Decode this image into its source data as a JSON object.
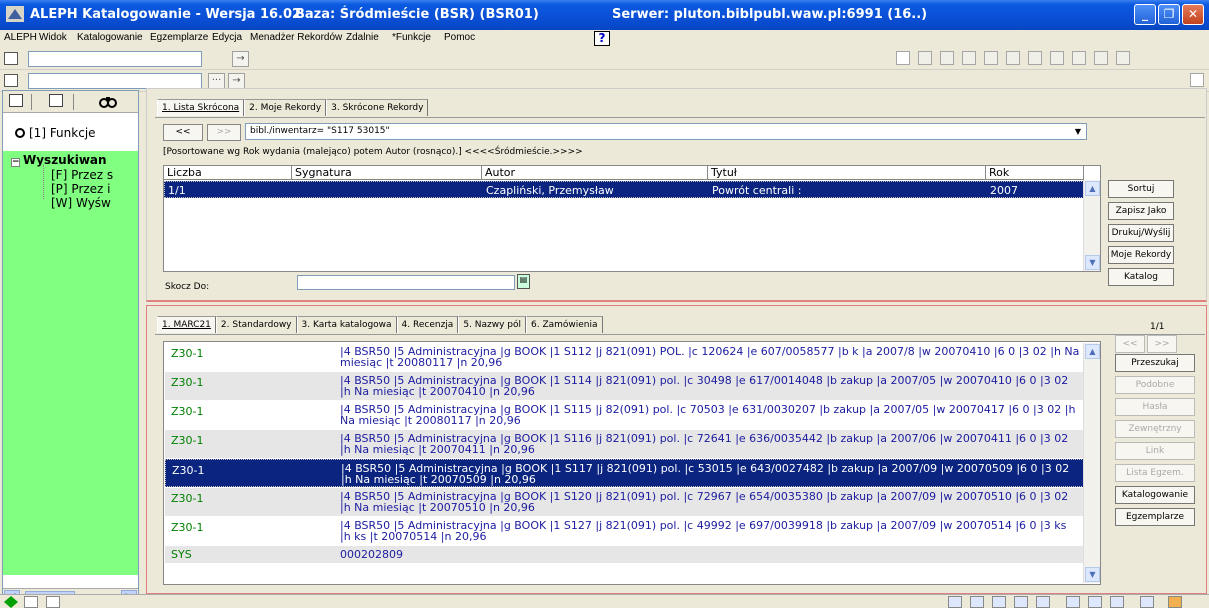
{
  "window": {
    "app_title": "ALEPH Katalogowanie - Wersja 16.02",
    "base": "Baza:  Śródmieście (BSR) (BSR01)",
    "server": "Serwer:  pluton.biblpubl.waw.pl:6991 (16..)"
  },
  "menu": [
    "ALEPH",
    "Widok",
    "Katalogowanie",
    "Egzemplarze",
    "Edycja",
    "Menadżer Rekordów",
    "Zdalnie",
    "*Funkcje",
    "Pomoc"
  ],
  "help_label": "?",
  "toolbar": {
    "arrow": "→",
    "dots": "···"
  },
  "left_panel": {
    "funkcje": "[1] Funkcje",
    "tree_root": "Wyszukiwan",
    "tree_expander": "−",
    "items": [
      "[F] Przez s",
      "[P] Przez i",
      "[W] Wyśw"
    ]
  },
  "upper": {
    "tabs": [
      "1. Lista Skrócona",
      "2. Moje Rekordy",
      "3. Skrócone Rekordy"
    ],
    "nav_prev": "<<",
    "nav_next": ">>",
    "query": "bibl./inwentarz= \"S117 53015\"",
    "sorted_note": "[Posortowane wg Rok wydania (malejąco) potem Autor (rosnąco).]   <<<<Śródmieście.>>>>",
    "columns": [
      "Liczba",
      "Sygnatura",
      "Autor",
      "Tytuł",
      "Rok"
    ],
    "rows": [
      {
        "liczba": "1/1",
        "sygnatura": "",
        "autor": "Czapliński, Przemysław",
        "tytul": "Powrót centrali :",
        "rok": "2007"
      }
    ],
    "skocz_label": "Skocz Do:",
    "buttons": [
      "Sortuj",
      "Zapisz Jako",
      "Drukuj/Wyślij",
      "Moje Rekordy",
      "Katalog"
    ]
  },
  "lower": {
    "tabs": [
      "1. MARC21",
      "2. Standardowy",
      "3. Karta katalogowa",
      "4. Recenzja",
      "5. Nazwy pól",
      "6. Zamówienia"
    ],
    "pager": "1/1",
    "pager_prev": "<<",
    "pager_next": ">>",
    "rows": [
      {
        "tag": "Z30-1",
        "value": "|4 BSR50 |5 Administracyjna |g BOOK |1 S112 |j 821(091)  POL. |c 120624 |e 607/0058577 |b k |a 2007/8 |w 20070410 |6 0 |3 02 |h Na miesiąc |t 20080117 |n 20,96"
      },
      {
        "tag": "Z30-1",
        "value": "|4 BSR50 |5 Administracyjna |g BOOK |1 S114 |j 821(091) pol. |c 30498 |e 617/0014048 |b zakup |a 2007/05 |w 20070410 |6 0 |3 02 |h Na miesiąc |t 20070410 |n 20,96"
      },
      {
        "tag": "Z30-1",
        "value": "|4 BSR50 |5 Administracyjna |g BOOK |1 S115 |j 82(091) pol. |c 70503 |e 631/0030207 |b zakup |a 2007/05 |w 20070417 |6 0 |3 02 |h Na miesiąc |t 20080117 |n 20,96"
      },
      {
        "tag": "Z30-1",
        "value": "|4 BSR50 |5 Administracyjna |g BOOK |1 S116 |j 821(091) pol. |c 72641 |e 636/0035442 |b zakup |a 2007/06 |w 20070411 |6 0 |3 02 |h Na miesiąc |t 20070411 |n 20,96"
      },
      {
        "tag": "Z30-1",
        "value": "|4 BSR50 |5 Administracyjna |g BOOK |1 S117 |j 821(091) pol. |c 53015 |e 643/0027482 |b zakup |a 2007/09 |w 20070509 |6 0 |3 02 |h Na miesiąc |t 20070509 |n 20,96"
      },
      {
        "tag": "Z30-1",
        "value": "|4 BSR50 |5 Administracyjna |g BOOK |1 S120 |j 821(091) pol. |c 72967 |e 654/0035380 |b zakup |a 2007/09 |w 20070510 |6 0 |3 02 |h Na miesiąc |t 20070510 |n 20,96"
      },
      {
        "tag": "Z30-1",
        "value": "|4 BSR50 |5 Administracyjna |g BOOK |1 S127 |j 821(091) pol. |c 49992 |e 697/0039918 |b zakup |a 2007/09 |w 20070514 |6 0 |3 ks |h ks |t 20070514 |n 20,96"
      },
      {
        "tag": "SYS",
        "value": "000202809"
      }
    ],
    "buttons": [
      "Przeszukaj",
      "Podobne",
      "Hasła",
      "Zewnętrzny",
      "Link",
      "Lista Egzem.",
      "Katalogowanie",
      "Egzemplarze"
    ]
  },
  "colors": {
    "selection": "#0a2480",
    "tag_green": "#008000",
    "value_blue": "#1c1ca0",
    "tree_bg": "#80ff80"
  }
}
